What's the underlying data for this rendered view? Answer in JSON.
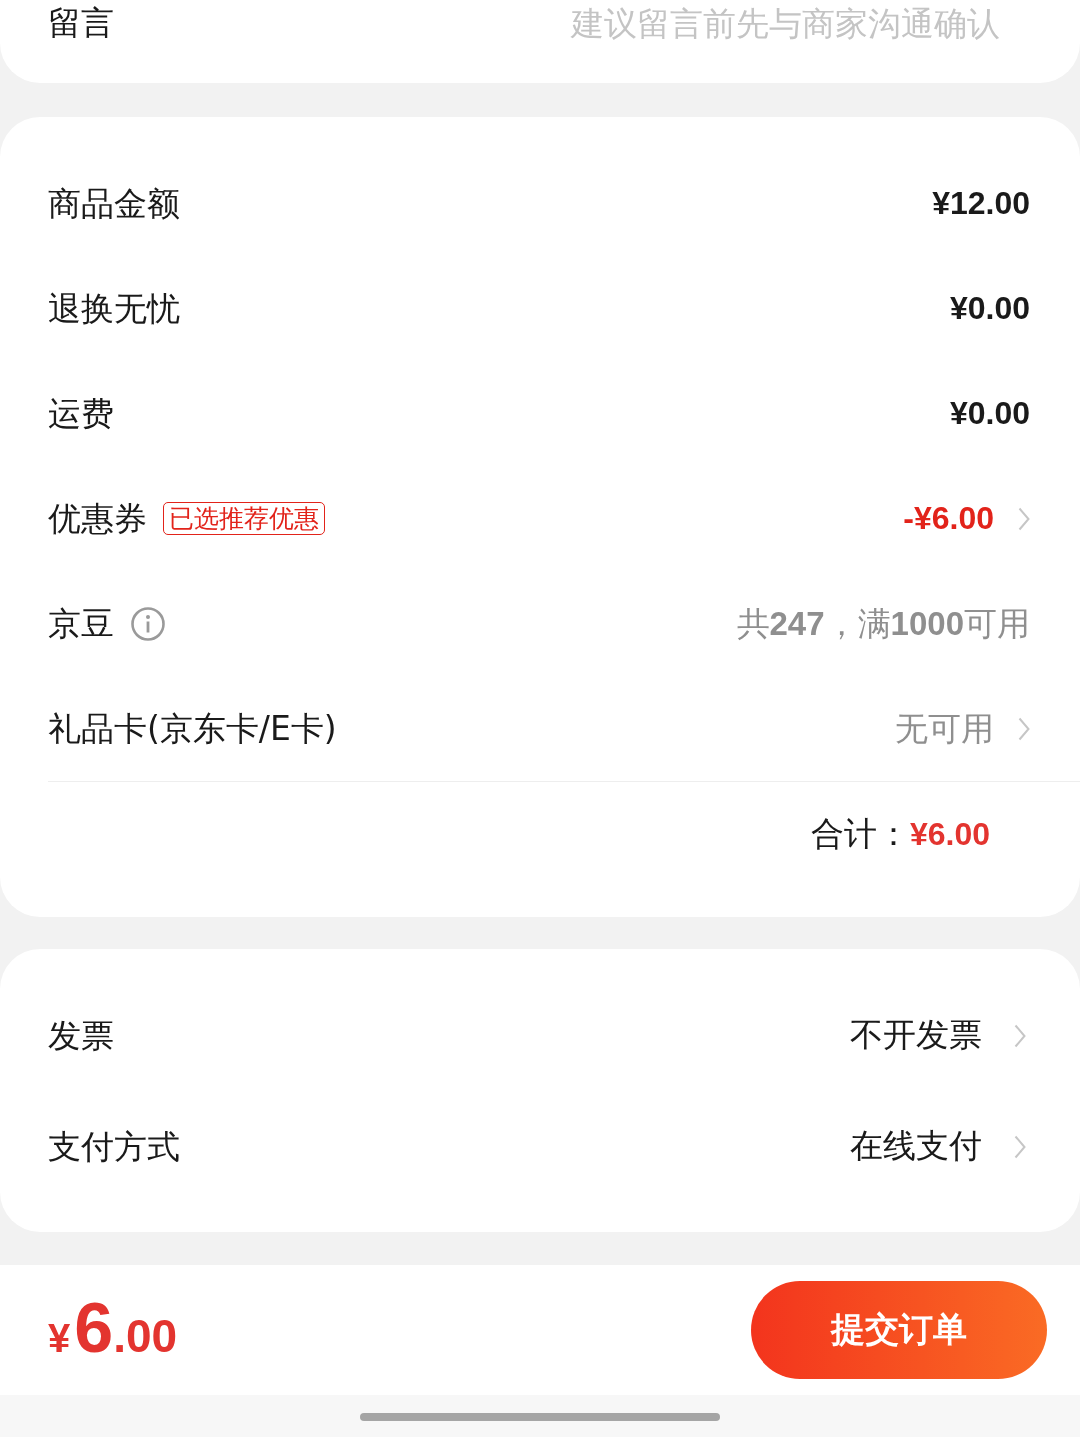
{
  "message_row": {
    "label": "留言",
    "placeholder": "建议留言前先与商家沟通确认"
  },
  "summary": {
    "rows": [
      {
        "kind": "amount",
        "label": "商品金额",
        "value": "¥12.00",
        "chevron": false
      },
      {
        "kind": "amount",
        "label": "退换无忧",
        "value": "¥0.00",
        "chevron": false
      },
      {
        "kind": "amount",
        "label": "运费",
        "value": "¥0.00",
        "chevron": false
      },
      {
        "kind": "coupon",
        "label": "优惠券",
        "badge": "已选推荐优惠",
        "value": "-¥6.00",
        "chevron": true
      },
      {
        "kind": "points",
        "label": "京豆",
        "value": "共**247**，满**1000**可用",
        "chevron": false
      },
      {
        "kind": "card",
        "label": "礼品卡(京东卡/E卡)",
        "value": "无可用",
        "chevron": true
      }
    ],
    "total": {
      "label": "合计：",
      "value": "¥6.00"
    }
  },
  "options": [
    {
      "label": "发票",
      "value": "不开发票",
      "chevron": true
    },
    {
      "label": "支付方式",
      "value": "在线支付",
      "chevron": true
    }
  ],
  "bottom_bar": {
    "price": {
      "symbol": "¥",
      "integer": "6",
      "decimal": ".00"
    },
    "submit_button": "提交订单"
  }
}
